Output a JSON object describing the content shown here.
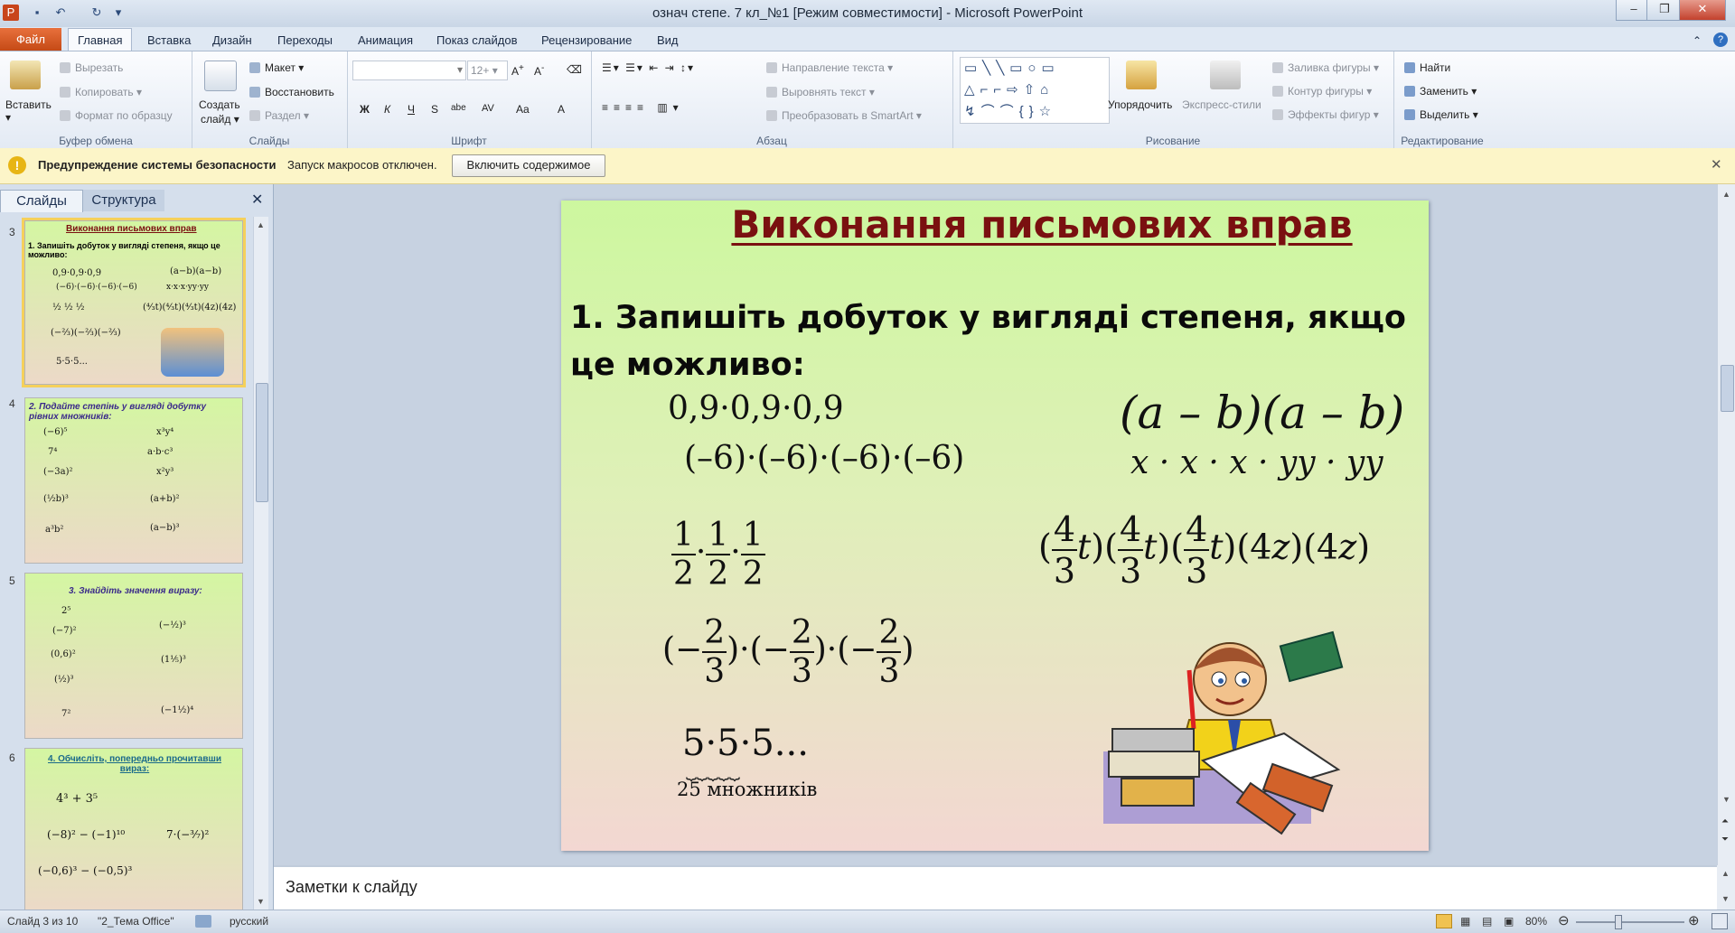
{
  "window": {
    "title": "означ степе. 7 кл_№1 [Режим совместимости] - Microsoft PowerPoint",
    "minimize": "–",
    "maximize": "❐",
    "close": "✕"
  },
  "tabs": [
    "Файл",
    "Главная",
    "Вставка",
    "Дизайн",
    "Переходы",
    "Анимация",
    "Показ слайдов",
    "Рецензирование",
    "Вид"
  ],
  "ribbon": {
    "clipboard": {
      "label": "Буфер обмена",
      "paste": "Вставить",
      "cut": "Вырезать",
      "copy": "Копировать",
      "format": "Формат по образцу"
    },
    "slides": {
      "label": "Слайды",
      "new_slide_1": "Создать",
      "new_slide_2": "слайд",
      "layout": "Макет",
      "reset": "Восстановить",
      "section": "Раздел"
    },
    "font": {
      "label": "Шрифт",
      "size": "12+",
      "bold": "Ж",
      "italic": "К",
      "underline": "Ч",
      "strike": "S",
      "shadow": "abe",
      "spacing": "AV",
      "case": "Aa",
      "color": "A"
    },
    "paragraph": {
      "label": "Абзац",
      "text_direction": "Направление текста",
      "align_text": "Выровнять текст",
      "smartart": "Преобразовать в SmartArt"
    },
    "drawing": {
      "label": "Рисование",
      "arrange": "Упорядочить",
      "quick_styles": "Экспресс-стили",
      "shape_fill": "Заливка фигуры",
      "shape_outline": "Контур фигуры",
      "shape_effects": "Эффекты фигур"
    },
    "editing": {
      "label": "Редактирование",
      "find": "Найти",
      "replace": "Заменить",
      "select": "Выделить"
    }
  },
  "security": {
    "title": "Предупреждение системы безопасности",
    "message": "Запуск макросов отключен.",
    "button": "Включить содержимое"
  },
  "pane": {
    "tab_slides": "Слайды",
    "tab_outline": "Структура",
    "thumbs": [
      {
        "num": "3",
        "title": "Виконання письмових вправ",
        "task": "1. Запишіть добуток у вигляді степеня, якщо це можливо:"
      },
      {
        "num": "4",
        "title": "2. Подайте степінь у вигляді добутку рівних множників:"
      },
      {
        "num": "5",
        "title": "3. Знайдіть значення виразу:"
      },
      {
        "num": "6",
        "title": "4. Обчисліть, попередньо прочитавши вираз:"
      }
    ]
  },
  "slide": {
    "title": "Виконання письмових вправ",
    "task": "1. Запишіть добуток у вигляді степеня, якщо це можливо:",
    "expr1": "0,9·0,9·0,9",
    "expr2": "(–6)·(–6)·(–6)·(–6)",
    "expr3": "(a – b)(a – b)",
    "expr4": "x · x · x · yy · yy",
    "expr_mult": "5·5·5...",
    "expr_mult_note": "25 множників"
  },
  "notes": {
    "placeholder": "Заметки к слайду"
  },
  "status": {
    "slide": "Слайд 3 из 10",
    "theme": "\"2_Тема Office\"",
    "lang": "русский",
    "zoom": "80%"
  }
}
